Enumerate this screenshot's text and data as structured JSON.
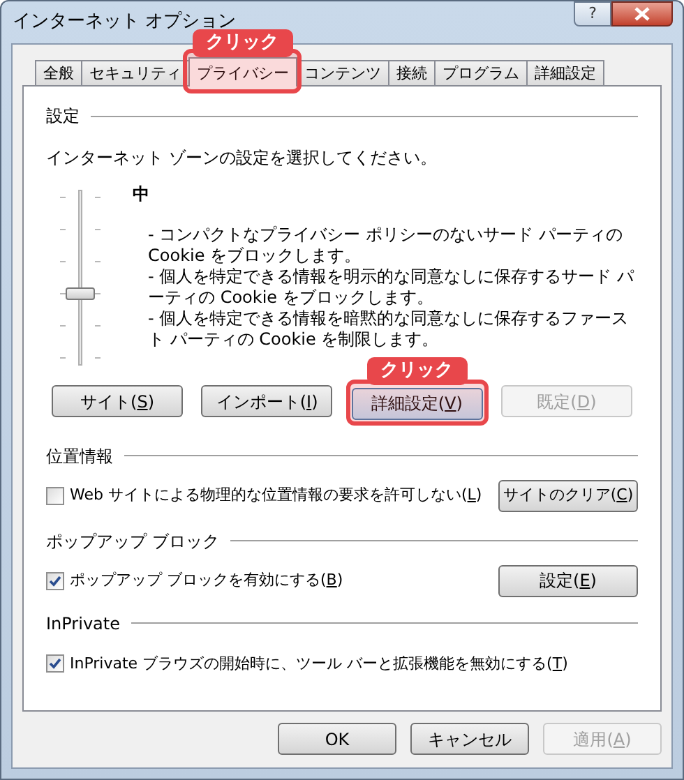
{
  "window": {
    "title": "インターネット オプション",
    "help": "?"
  },
  "tabs": [
    {
      "label": "全般",
      "selected": false
    },
    {
      "label": "セキュリティ",
      "selected": false
    },
    {
      "label": "プライバシー",
      "selected": true,
      "callout": "クリック"
    },
    {
      "label": "コンテンツ",
      "selected": false
    },
    {
      "label": "接続",
      "selected": false
    },
    {
      "label": "プログラム",
      "selected": false
    },
    {
      "label": "詳細設定",
      "selected": false
    }
  ],
  "settings": {
    "heading": "設定",
    "instruction": "インターネット ゾーンの設定を選択してください。",
    "slider": {
      "level": 0.4
    },
    "level_name": "中",
    "description": [
      "- コンパクトなプライバシー ポリシーのないサード パーティの Cookie をブロックします。",
      "- 個人を特定できる情報を明示的な同意なしに保存するサード パーティの Cookie をブロックします。",
      "- 個人を特定できる情報を暗黙的な同意なしに保存するファースト パーティの Cookie を制限します。"
    ],
    "buttons": [
      {
        "label": "サイト(S)",
        "disabled": false
      },
      {
        "label": "インポート(I)",
        "disabled": false
      },
      {
        "label": "詳細設定(V)",
        "disabled": false,
        "callout": "クリック"
      },
      {
        "label": "既定(D)",
        "disabled": true
      }
    ]
  },
  "location": {
    "heading": "位置情報",
    "checkbox": {
      "label": "Web サイトによる物理的な位置情報の要求を許可しない(L)",
      "checked": false
    },
    "button": "サイトのクリア(C)"
  },
  "popup": {
    "heading": "ポップアップ ブロック",
    "checkbox": {
      "label": "ポップアップ ブロックを有効にする(B)",
      "checked": true
    },
    "button": "設定(E)"
  },
  "inprivate": {
    "heading": "InPrivate",
    "checkbox": {
      "label": "InPrivate ブラウズの開始時に、ツール バーと拡張機能を無効にする(T)",
      "checked": true
    }
  },
  "footer": [
    {
      "label": "OK",
      "disabled": false
    },
    {
      "label": "キャンセル",
      "disabled": false
    },
    {
      "label": "適用(A)",
      "disabled": true
    }
  ]
}
